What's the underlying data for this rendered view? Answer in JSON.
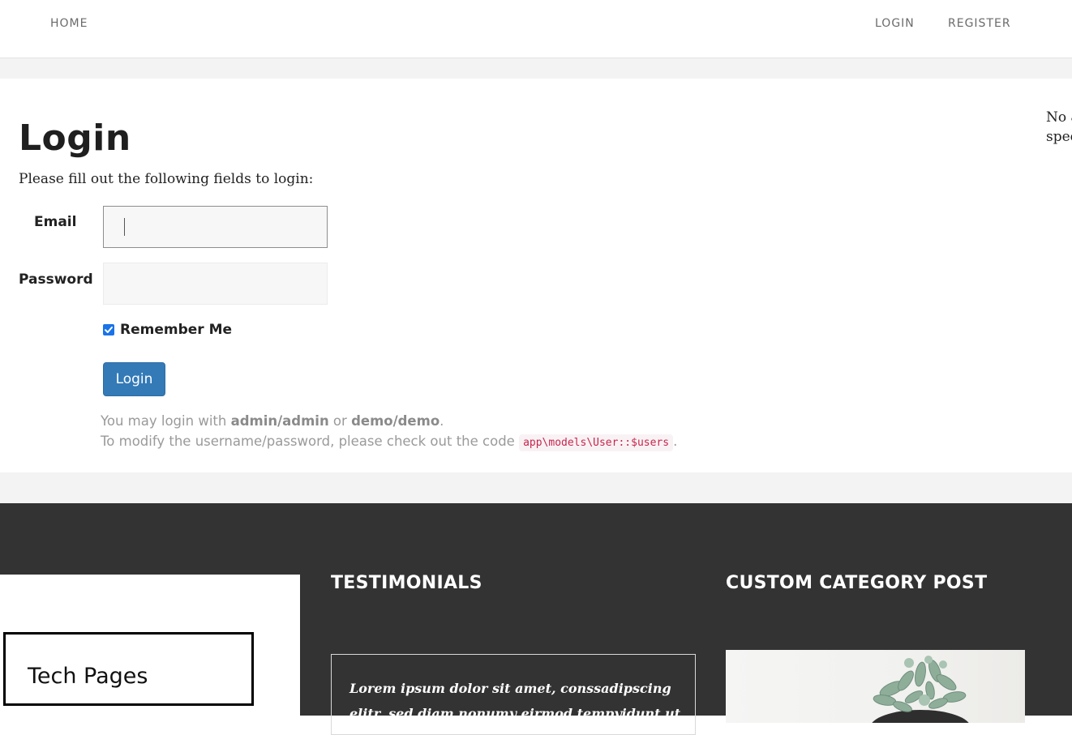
{
  "nav": {
    "home": "HOME",
    "login": "LOGIN",
    "register": "REGISTER"
  },
  "page": {
    "title": "Login",
    "intro": "Please fill out the following fields to login:"
  },
  "form": {
    "email_label": "Email",
    "email_value": "",
    "password_label": "Password",
    "password_value": "",
    "remember_label": "Remember Me",
    "remember_checked": true,
    "submit_label": "Login"
  },
  "hint": {
    "line1_prefix": "You may login with ",
    "cred1": "admin/admin",
    "line1_or": " or ",
    "cred2": "demo/demo",
    "line1_end": ".",
    "line2_prefix": "To modify the username/password, please check out the code ",
    "code": "app\\models\\User::$users",
    "line2_end": "."
  },
  "sidebar": {
    "line1": "No a",
    "line2": "spec"
  },
  "footer": {
    "widget_title": "Tech Pages",
    "testimonials_heading": "TESTIMONIALS",
    "testimonial_text": "Lorem ipsum dolor sit amet, conssadipscing elitr, sed diam nonumy eirmod tempyidunt ut labore et dolore",
    "category_heading": "CUSTOM CATEGORY POST",
    "category_image_icon": "succulent-plant-photo"
  },
  "colors": {
    "primary_button": "#337ab7",
    "checkbox": "#1a73e8",
    "footer_bg": "#333333",
    "code_text": "#c7254e"
  }
}
